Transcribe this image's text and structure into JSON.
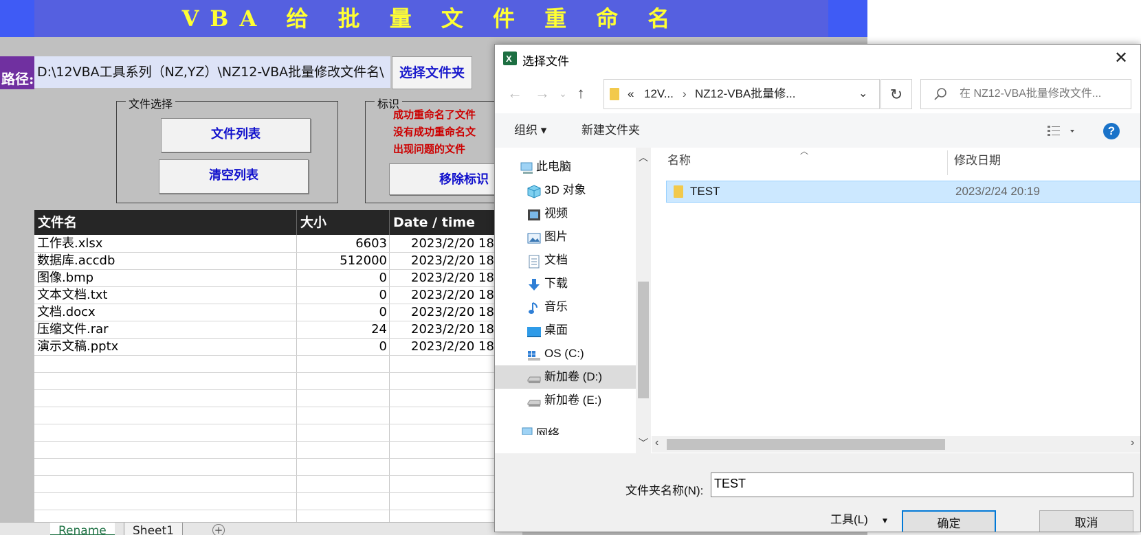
{
  "excel": {
    "banner_title": "VBA 给 批 量 文 件 重 命 名",
    "path_label": "路径:",
    "path_value": "D:\\12VBA工具系列（NZ,YZ）\\NZ12-VBA批量修改文件名\\",
    "choose_folder_label": "选择文件夹",
    "file_group": {
      "title": "文件选择",
      "list_button": "文件列表",
      "clear_button": "清空列表"
    },
    "mark_group": {
      "title": "标识",
      "legend": [
        "成功重命名了文件",
        "没有成功重命名文",
        "出现问题的文件"
      ],
      "remove_button": "移除标识"
    },
    "table": {
      "headers": [
        "文件名",
        "大小",
        "Date / time"
      ],
      "rows": [
        {
          "name": "工作表.xlsx",
          "size": "6603",
          "date": "2023/2/20 18"
        },
        {
          "name": "数据库.accdb",
          "size": "512000",
          "date": "2023/2/20 18"
        },
        {
          "name": "图像.bmp",
          "size": "0",
          "date": "2023/2/20 18"
        },
        {
          "name": "文本文档.txt",
          "size": "0",
          "date": "2023/2/20 18"
        },
        {
          "name": "文档.docx",
          "size": "0",
          "date": "2023/2/20 18"
        },
        {
          "name": "压缩文件.rar",
          "size": "24",
          "date": "2023/2/20 18"
        },
        {
          "name": "演示文稿.pptx",
          "size": "0",
          "date": "2023/2/20 18"
        }
      ]
    },
    "sheet_tabs": [
      "Rename",
      "Sheet1"
    ],
    "colors": {
      "banner": "#5560e0",
      "banner_text": "#ffff33",
      "path_label_bg": "#7030a0",
      "legend_text": "#cc0000"
    }
  },
  "dialog": {
    "title": "选择文件",
    "address": {
      "overflow": "«",
      "crumb1": "12V...",
      "crumb2": "NZ12-VBA批量修..."
    },
    "search_placeholder": "在 NZ12-VBA批量修改文件...",
    "toolbar": {
      "organize": "组织 ▾",
      "new_folder": "新建文件夹"
    },
    "nav_items": [
      {
        "label": "此电脑",
        "icon": "computer-icon"
      },
      {
        "label": "3D 对象",
        "icon": "3d-objects-icon"
      },
      {
        "label": "视频",
        "icon": "video-icon"
      },
      {
        "label": "图片",
        "icon": "pictures-icon"
      },
      {
        "label": "文档",
        "icon": "documents-icon"
      },
      {
        "label": "下载",
        "icon": "downloads-icon"
      },
      {
        "label": "音乐",
        "icon": "music-icon"
      },
      {
        "label": "桌面",
        "icon": "desktop-icon"
      },
      {
        "label": "OS (C:)",
        "icon": "os-drive-icon"
      },
      {
        "label": "新加卷 (D:)",
        "icon": "drive-icon"
      },
      {
        "label": "新加卷 (E:)",
        "icon": "drive-icon"
      },
      {
        "label": "网络",
        "icon": "network-icon"
      }
    ],
    "columns": {
      "name": "名称",
      "modified": "修改日期"
    },
    "files": [
      {
        "name": "TEST",
        "modified": "2023/2/24 20:19"
      }
    ],
    "folder_name_label": "文件夹名称(N):",
    "folder_name_value": "TEST",
    "tools_label": "工具(L)",
    "ok_label": "确定",
    "cancel_label": "取消",
    "colors": {
      "selected_row": "#cce8ff",
      "accent": "#0078d7",
      "help": "#1a73c9"
    }
  }
}
